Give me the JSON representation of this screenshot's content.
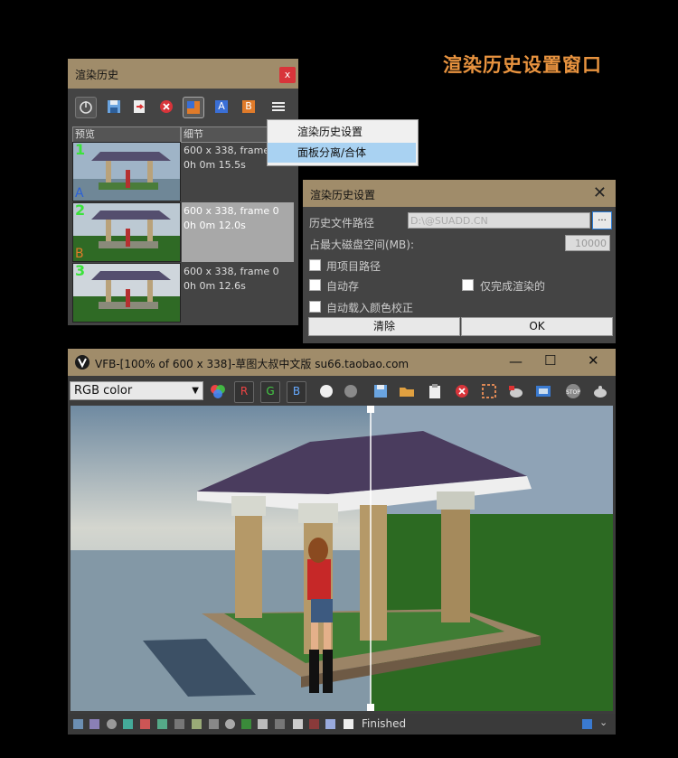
{
  "headline": "渲染历史设置窗口",
  "history_panel": {
    "title": "渲染历史",
    "close": "x",
    "toolbar": {
      "a_label": "A",
      "b_label": "B"
    },
    "columns": [
      "预览",
      "细节"
    ],
    "rows": [
      {
        "num": "1",
        "info": "600 x 338, frame 0",
        "time": "0h 0m 15.5s",
        "tag": "A",
        "tag_color": "#2b60d6"
      },
      {
        "num": "2",
        "info": "600 x 338, frame 0",
        "time": "0h 0m 12.0s",
        "tag": "B",
        "tag_color": "#e07b2a"
      },
      {
        "num": "3",
        "info": "600 x 338, frame 0",
        "time": "0h 0m 12.6s",
        "tag": "",
        "tag_color": ""
      }
    ]
  },
  "menu": {
    "items": [
      "渲染历史设置",
      "面板分离/合体"
    ]
  },
  "settings": {
    "title": "渲染历史设置",
    "path_label": "历史文件路径",
    "path_value": "D:\\@SUADD.CN",
    "browse": "...",
    "disk_label": "占最大磁盘空间(MB):",
    "disk_value": "10000",
    "use_project_path": "用项目路径",
    "autosave": "自动存",
    "only_finished": "仅完成渲染的",
    "auto_load_cc": "自动载入颜色校正",
    "clear_btn": "清除",
    "ok_btn": "OK"
  },
  "vfb": {
    "title": "VFB-[100% of 600 x 338]-草图大叔中文版 su66.taobao.com",
    "channel": "RGB color",
    "r": "R",
    "g": "G",
    "b": "B",
    "status": "Finished",
    "minimize": "—",
    "maximize": "☐",
    "close": "✕"
  },
  "colors": {
    "title_bar": "#a08c6a",
    "accent": "#e8933f",
    "selected_menu": "#a9d2f2",
    "close_red": "#d8343a"
  }
}
